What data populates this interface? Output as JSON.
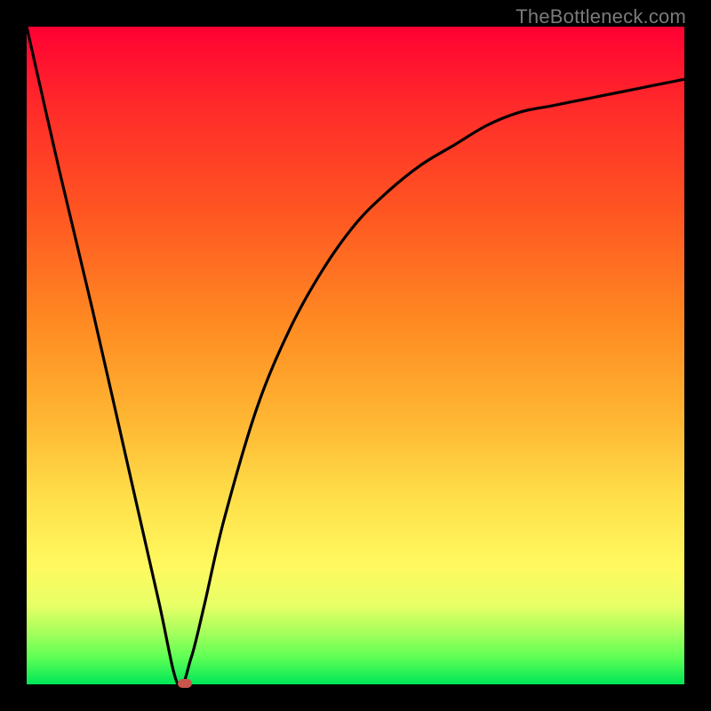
{
  "watermark": "TheBottleneck.com",
  "colors": {
    "frame": "#000000",
    "curve": "#000000",
    "marker": "#c9564b"
  },
  "chart_data": {
    "type": "line",
    "title": "",
    "xlabel": "",
    "ylabel": "",
    "xlim": [
      0,
      100
    ],
    "ylim": [
      0,
      100
    ],
    "grid": false,
    "legend": false,
    "series": [
      {
        "name": "bottleneck-curve",
        "x": [
          0,
          5,
          10,
          15,
          20,
          23,
          25,
          27,
          30,
          35,
          40,
          45,
          50,
          55,
          60,
          65,
          70,
          75,
          80,
          85,
          90,
          95,
          100
        ],
        "y": [
          100,
          78,
          57,
          35,
          13,
          0,
          4,
          12,
          25,
          42,
          54,
          63,
          70,
          75,
          79,
          82,
          85,
          87,
          88,
          89,
          90,
          91,
          92
        ]
      }
    ],
    "marker": {
      "x": 24,
      "y": 0
    },
    "background_gradient": {
      "top": "#ff0033",
      "bottom": "#00e658"
    }
  }
}
